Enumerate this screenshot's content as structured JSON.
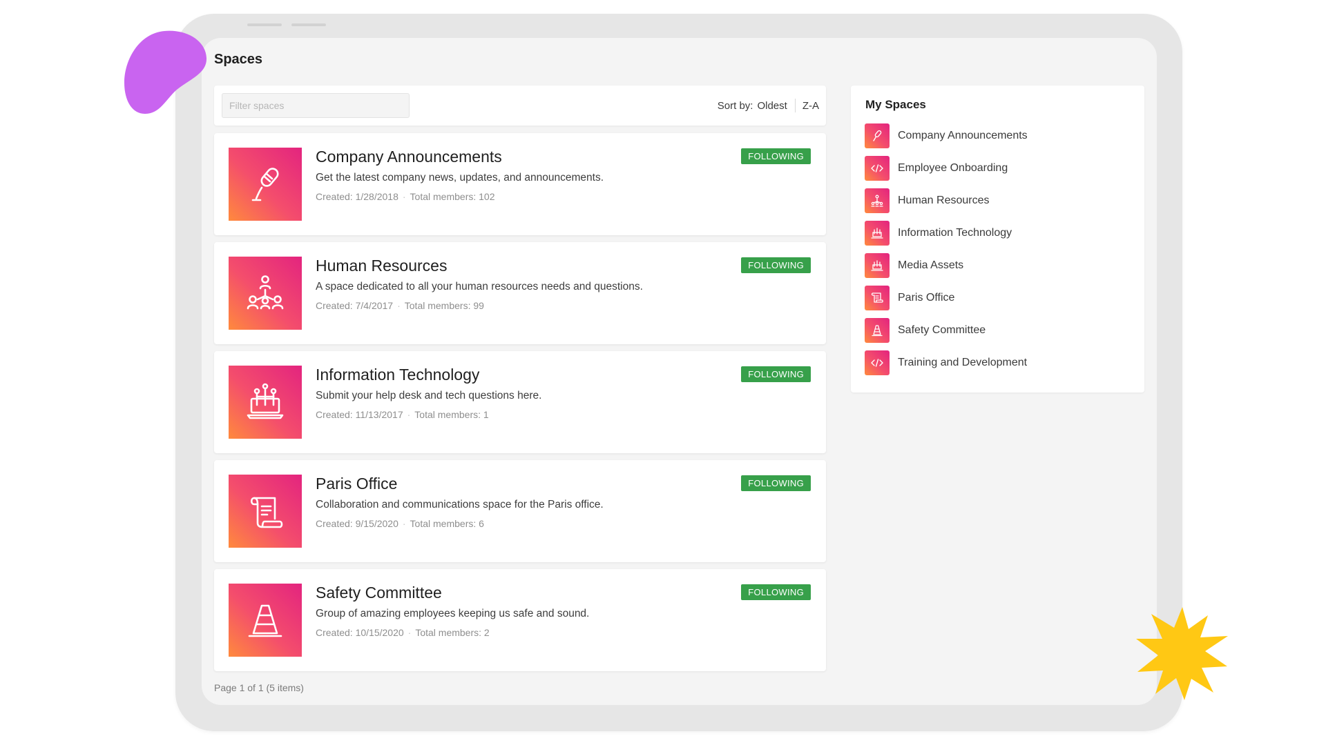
{
  "page": {
    "title": "Spaces"
  },
  "toolbar": {
    "filter_placeholder": "Filter spaces",
    "sort_label": "Sort by:",
    "sort_value": "Oldest",
    "order_value": "Z-A"
  },
  "spaces": [
    {
      "icon": "microphone-icon",
      "title": "Company Announcements",
      "description": "Get the latest company news, updates, and announcements.",
      "created": "Created: 1/28/2018",
      "members": "Total members: 102",
      "badge": "FOLLOWING"
    },
    {
      "icon": "people-network-icon",
      "title": "Human Resources",
      "description": "A space dedicated to all your human resources needs and questions.",
      "created": "Created: 7/4/2017",
      "members": "Total members: 99",
      "badge": "FOLLOWING"
    },
    {
      "icon": "laptop-network-icon",
      "title": "Information Technology",
      "description": "Submit your help desk and tech questions here.",
      "created": "Created: 11/13/2017",
      "members": "Total members: 1",
      "badge": "FOLLOWING"
    },
    {
      "icon": "scroll-icon",
      "title": "Paris Office",
      "description": "Collaboration and communications space for the Paris office.",
      "created": "Created: 9/15/2020",
      "members": "Total members: 6",
      "badge": "FOLLOWING"
    },
    {
      "icon": "traffic-cone-icon",
      "title": "Safety Committee",
      "description": "Group of amazing employees keeping us safe and sound.",
      "created": "Created: 10/15/2020",
      "members": "Total members: 2",
      "badge": "FOLLOWING"
    }
  ],
  "pager": {
    "text": "Page 1 of 1 (5 items)"
  },
  "my_spaces": {
    "title": "My Spaces",
    "items": [
      {
        "label": "Company Announcements",
        "icon": "microphone-icon"
      },
      {
        "label": "Employee Onboarding",
        "icon": "code-icon"
      },
      {
        "label": "Human Resources",
        "icon": "people-network-icon"
      },
      {
        "label": "Information Technology",
        "icon": "laptop-network-icon"
      },
      {
        "label": "Media Assets",
        "icon": "laptop-network-icon"
      },
      {
        "label": "Paris Office",
        "icon": "scroll-icon"
      },
      {
        "label": "Safety Committee",
        "icon": "traffic-cone-icon"
      },
      {
        "label": "Training and Development",
        "icon": "code-icon"
      }
    ]
  },
  "colors": {
    "badge_green": "#37a04a",
    "tile_gradient_start": "#e3247f",
    "tile_gradient_end": "#ff8a3d",
    "blob_purple": "#c964f0",
    "burst_yellow": "#ffc814"
  }
}
